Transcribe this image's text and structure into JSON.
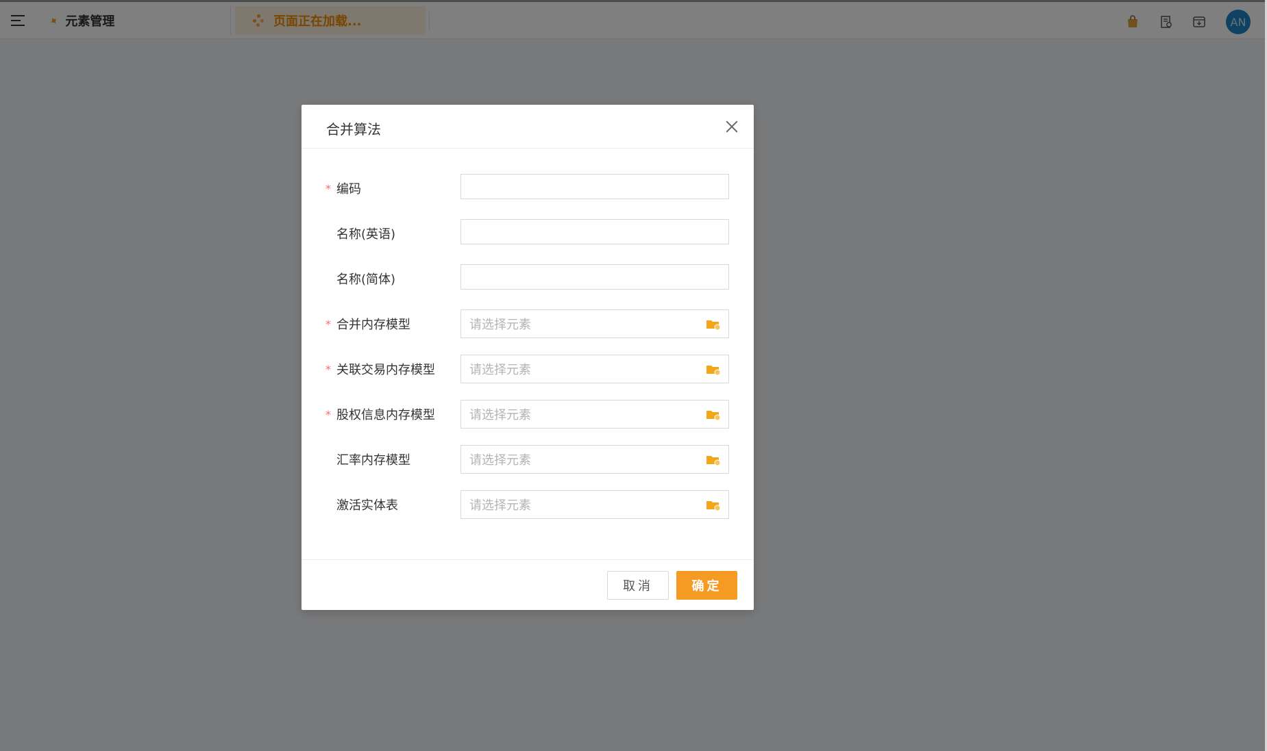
{
  "header": {
    "tabs": [
      {
        "label": "元素管理"
      },
      {
        "label": "页面正在加载..."
      }
    ],
    "avatar_initials": "AN"
  },
  "dialog": {
    "title": "合并算法",
    "fields": [
      {
        "label": "编码",
        "required": true,
        "type": "text",
        "value": ""
      },
      {
        "label": "名称(英语)",
        "required": false,
        "type": "text",
        "value": ""
      },
      {
        "label": "名称(简体)",
        "required": false,
        "type": "text",
        "value": ""
      },
      {
        "label": "合并内存模型",
        "required": true,
        "type": "select",
        "placeholder": "请选择元素"
      },
      {
        "label": "关联交易内存模型",
        "required": true,
        "type": "select",
        "placeholder": "请选择元素"
      },
      {
        "label": "股权信息内存模型",
        "required": true,
        "type": "select",
        "placeholder": "请选择元素"
      },
      {
        "label": "汇率内存模型",
        "required": false,
        "type": "select",
        "placeholder": "请选择元素"
      },
      {
        "label": "激活实体表",
        "required": false,
        "type": "select",
        "placeholder": "请选择元素"
      }
    ],
    "required_mark": "*",
    "cancel_label": "取消",
    "ok_label": "确定"
  },
  "colors": {
    "accent": "#f59a23",
    "required": "#f56c6c",
    "avatar_bg": "#1f84c4"
  }
}
